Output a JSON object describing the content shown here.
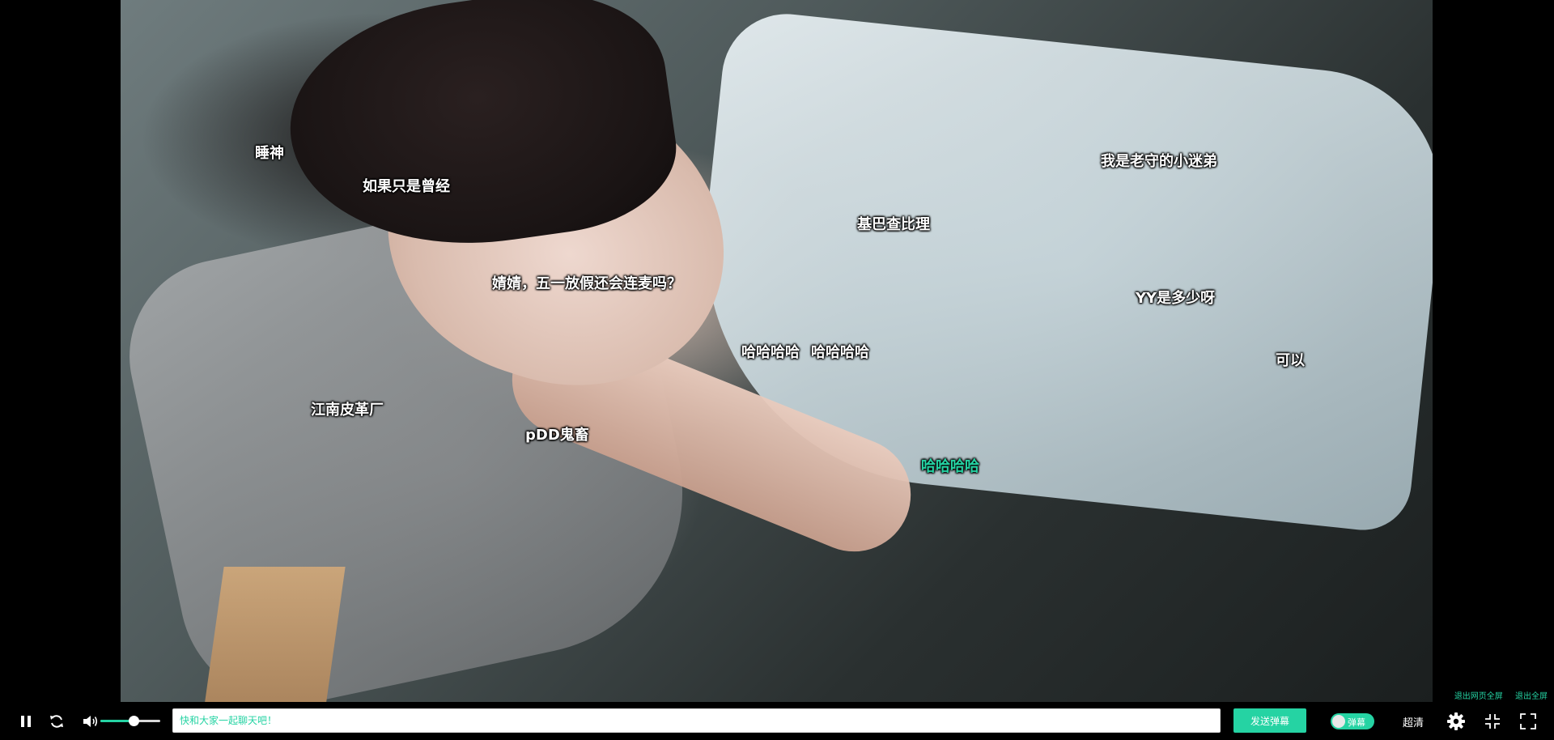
{
  "video": {
    "danmaku": [
      {
        "text": "睡神",
        "color": "#ffffff"
      },
      {
        "text": "如果只是曾经",
        "color": "#ffffff"
      },
      {
        "text": "婧婧，五一放假还会连麦吗？",
        "color": "#ffffff"
      },
      {
        "text": "基巴查比理",
        "color": "#ffffff"
      },
      {
        "text": "我是老守的小迷弟",
        "color": "#ffffff"
      },
      {
        "text": "YY是多少呀",
        "color": "#ffffff"
      },
      {
        "text": "哈哈哈哈",
        "color": "#ffffff"
      },
      {
        "text": "哈哈哈哈",
        "color": "#ffffff"
      },
      {
        "text": "可以",
        "color": "#ffffff"
      },
      {
        "text": "江南皮革厂",
        "color": "#ffffff"
      },
      {
        "text": "pDD鬼畜",
        "color": "#ffffff"
      },
      {
        "text": "哈哈哈哈",
        "color": "#25d3a3"
      }
    ],
    "exit_web_fullscreen_label": "退出网页全屏",
    "exit_fullscreen_label": "退出全屏"
  },
  "controls": {
    "play_state": "pause-icon",
    "loop_icon": "loop-icon",
    "volume_icon": "volume-icon",
    "volume_level": 0.55,
    "input_placeholder": "快和大家一起聊天吧！",
    "input_value": "",
    "send_button_label": "发送弹幕",
    "danmaku_toggle_label": "弹幕",
    "danmaku_enabled": true,
    "quality_label": "超清",
    "settings_icon": "gear-icon",
    "web_fullscreen_icon": "exit-web-fullscreen-icon",
    "fullscreen_icon": "exit-fullscreen-icon"
  },
  "colors": {
    "accent": "#25d3a3",
    "background": "#000000"
  }
}
